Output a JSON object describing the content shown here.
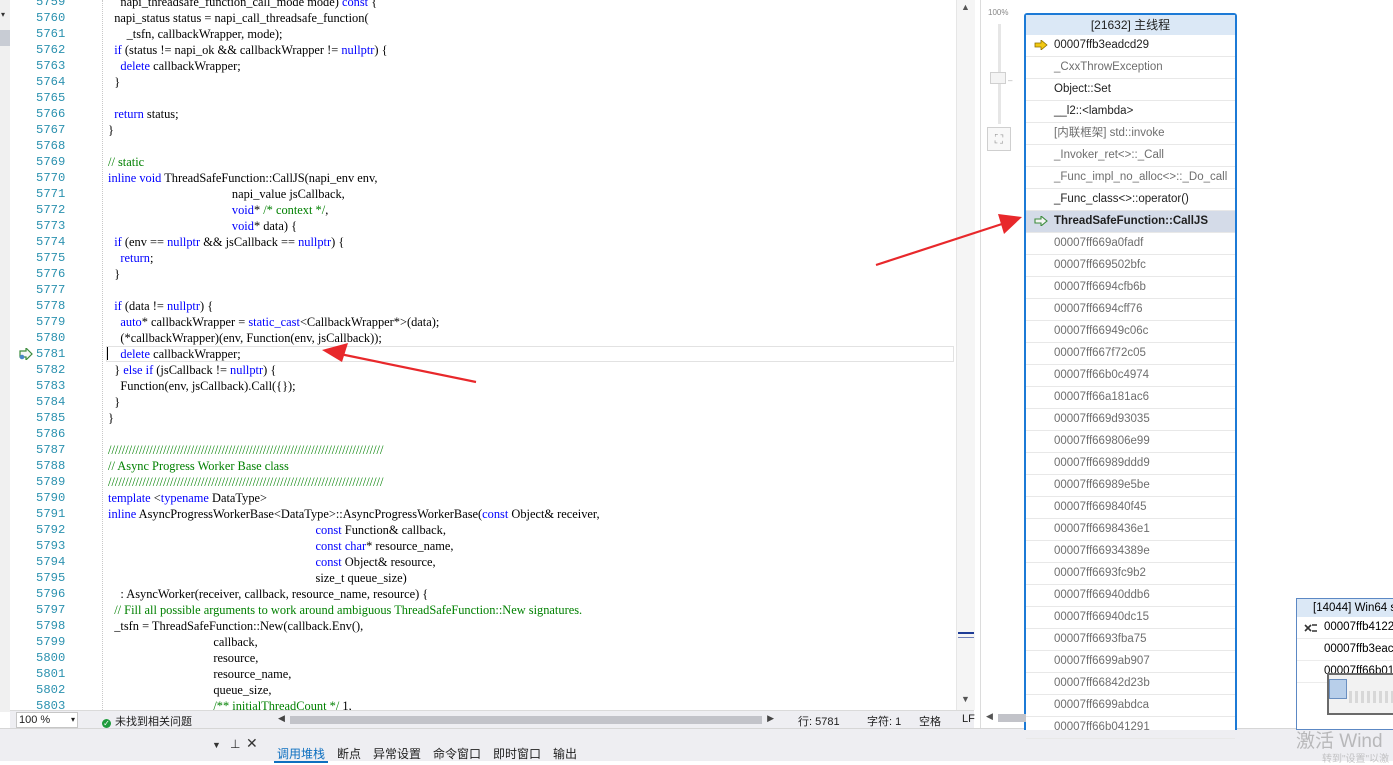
{
  "editor": {
    "zoom": "100 %",
    "issues": "未找到相关问题",
    "line_label": "行: 5781",
    "col_label": "字符: 1",
    "whitespace": "空格",
    "eol": "LF",
    "current_line": 5781,
    "breakpoint_line": 5781,
    "lines": [
      {
        "n": "5759",
        "parts": [
          [
            "",
            "    napi_threadsafe_function_call_mode mode) "
          ],
          [
            "kw",
            "const"
          ],
          [
            "",
            " {"
          ]
        ]
      },
      {
        "n": "5760",
        "parts": [
          [
            "",
            "  napi_status status = napi_call_threadsafe_function("
          ]
        ]
      },
      {
        "n": "5761",
        "parts": [
          [
            "",
            "      _tsfn, callbackWrapper, mode);"
          ]
        ]
      },
      {
        "n": "5762",
        "parts": [
          [
            "",
            "  "
          ],
          [
            "kw",
            "if"
          ],
          [
            "",
            " (status != napi_ok && callbackWrapper != "
          ],
          [
            "kw",
            "nullptr"
          ],
          [
            "",
            ") {"
          ]
        ]
      },
      {
        "n": "5763",
        "parts": [
          [
            "",
            "    "
          ],
          [
            "kw",
            "delete"
          ],
          [
            "",
            " callbackWrapper;"
          ]
        ]
      },
      {
        "n": "5764",
        "parts": [
          [
            "",
            "  }"
          ]
        ]
      },
      {
        "n": "5765",
        "parts": [
          [
            "",
            ""
          ]
        ]
      },
      {
        "n": "5766",
        "parts": [
          [
            "",
            "  "
          ],
          [
            "kw",
            "return"
          ],
          [
            "",
            " status;"
          ]
        ]
      },
      {
        "n": "5767",
        "parts": [
          [
            "",
            "}"
          ]
        ]
      },
      {
        "n": "5768",
        "parts": [
          [
            "",
            ""
          ]
        ]
      },
      {
        "n": "5769",
        "parts": [
          [
            "cm",
            "// static"
          ]
        ]
      },
      {
        "n": "5770",
        "parts": [
          [
            "kw",
            "inline"
          ],
          [
            "",
            " "
          ],
          [
            "kw",
            "void"
          ],
          [
            "",
            " ThreadSafeFunction::CallJS(napi_env env,"
          ]
        ]
      },
      {
        "n": "5771",
        "parts": [
          [
            "",
            "                                        napi_value jsCallback,"
          ]
        ]
      },
      {
        "n": "5772",
        "parts": [
          [
            "",
            "                                        "
          ],
          [
            "kw",
            "void"
          ],
          [
            "",
            "* "
          ],
          [
            "cm",
            "/* context */"
          ],
          [
            "",
            ","
          ]
        ]
      },
      {
        "n": "5773",
        "parts": [
          [
            "",
            "                                        "
          ],
          [
            "kw",
            "void"
          ],
          [
            "",
            "* data) {"
          ]
        ]
      },
      {
        "n": "5774",
        "parts": [
          [
            "",
            "  "
          ],
          [
            "kw",
            "if"
          ],
          [
            "",
            " (env == "
          ],
          [
            "kw",
            "nullptr"
          ],
          [
            "",
            " && jsCallback == "
          ],
          [
            "kw",
            "nullptr"
          ],
          [
            "",
            ") {"
          ]
        ]
      },
      {
        "n": "5775",
        "parts": [
          [
            "",
            "    "
          ],
          [
            "kw",
            "return"
          ],
          [
            "",
            ";"
          ]
        ]
      },
      {
        "n": "5776",
        "parts": [
          [
            "",
            "  }"
          ]
        ]
      },
      {
        "n": "5777",
        "parts": [
          [
            "",
            ""
          ]
        ]
      },
      {
        "n": "5778",
        "parts": [
          [
            "",
            "  "
          ],
          [
            "kw",
            "if"
          ],
          [
            "",
            " (data != "
          ],
          [
            "kw",
            "nullptr"
          ],
          [
            "",
            ") {"
          ]
        ]
      },
      {
        "n": "5779",
        "parts": [
          [
            "",
            "    "
          ],
          [
            "kw",
            "auto"
          ],
          [
            "",
            "* callbackWrapper = "
          ],
          [
            "kw",
            "static_cast"
          ],
          [
            "",
            "<CallbackWrapper*>(data);"
          ]
        ]
      },
      {
        "n": "5780",
        "parts": [
          [
            "",
            "    (*callbackWrapper)(env, Function(env, jsCallback));"
          ]
        ]
      },
      {
        "n": "5781",
        "parts": [
          [
            "",
            "    "
          ],
          [
            "kw",
            "delete"
          ],
          [
            "",
            " callbackWrapper;"
          ]
        ]
      },
      {
        "n": "5782",
        "parts": [
          [
            "",
            "  } "
          ],
          [
            "kw",
            "else"
          ],
          [
            "",
            " "
          ],
          [
            "kw",
            "if"
          ],
          [
            "",
            " (jsCallback != "
          ],
          [
            "kw",
            "nullptr"
          ],
          [
            "",
            ") {"
          ]
        ]
      },
      {
        "n": "5783",
        "parts": [
          [
            "",
            "    Function(env, jsCallback).Call({});"
          ]
        ]
      },
      {
        "n": "5784",
        "parts": [
          [
            "",
            "  }"
          ]
        ]
      },
      {
        "n": "5785",
        "parts": [
          [
            "",
            "}"
          ]
        ]
      },
      {
        "n": "5786",
        "parts": [
          [
            "",
            ""
          ]
        ]
      },
      {
        "n": "5787",
        "parts": [
          [
            "cm",
            "////////////////////////////////////////////////////////////////////////////////"
          ]
        ]
      },
      {
        "n": "5788",
        "parts": [
          [
            "cm",
            "// Async Progress Worker Base class"
          ]
        ]
      },
      {
        "n": "5789",
        "parts": [
          [
            "cm",
            "////////////////////////////////////////////////////////////////////////////////"
          ]
        ]
      },
      {
        "n": "5790",
        "parts": [
          [
            "kw",
            "template"
          ],
          [
            "",
            " <"
          ],
          [
            "kw",
            "typename"
          ],
          [
            "",
            " DataType>"
          ]
        ]
      },
      {
        "n": "5791",
        "parts": [
          [
            "kw",
            "inline"
          ],
          [
            "",
            " AsyncProgressWorkerBase<DataType>::AsyncProgressWorkerBase("
          ],
          [
            "kw",
            "const"
          ],
          [
            "",
            " Object& receiver,"
          ]
        ]
      },
      {
        "n": "5792",
        "parts": [
          [
            "",
            "                                                                   "
          ],
          [
            "kw",
            "const"
          ],
          [
            "",
            " Function& callback,"
          ]
        ]
      },
      {
        "n": "5793",
        "parts": [
          [
            "",
            "                                                                   "
          ],
          [
            "kw",
            "const"
          ],
          [
            "",
            " "
          ],
          [
            "kw",
            "char"
          ],
          [
            "",
            "* resource_name,"
          ]
        ]
      },
      {
        "n": "5794",
        "parts": [
          [
            "",
            "                                                                   "
          ],
          [
            "kw",
            "const"
          ],
          [
            "",
            " Object& resource,"
          ]
        ]
      },
      {
        "n": "5795",
        "parts": [
          [
            "",
            "                                                                   size_t queue_size)"
          ]
        ]
      },
      {
        "n": "5796",
        "parts": [
          [
            "",
            "    : AsyncWorker(receiver, callback, resource_name, resource) {"
          ]
        ]
      },
      {
        "n": "5797",
        "parts": [
          [
            "",
            "  "
          ],
          [
            "cm",
            "// Fill all possible arguments to work around ambiguous ThreadSafeFunction::New signatures."
          ]
        ]
      },
      {
        "n": "5798",
        "parts": [
          [
            "",
            "  _tsfn = ThreadSafeFunction::New(callback.Env(),"
          ]
        ]
      },
      {
        "n": "5799",
        "parts": [
          [
            "",
            "                                  callback,"
          ]
        ]
      },
      {
        "n": "5800",
        "parts": [
          [
            "",
            "                                  resource,"
          ]
        ]
      },
      {
        "n": "5801",
        "parts": [
          [
            "",
            "                                  resource_name,"
          ]
        ]
      },
      {
        "n": "5802",
        "parts": [
          [
            "",
            "                                  queue_size,"
          ]
        ]
      },
      {
        "n": "5803",
        "parts": [
          [
            "",
            "                                  "
          ],
          [
            "cm",
            "/** initialThreadCount */"
          ],
          [
            "",
            " 1,"
          ]
        ]
      }
    ]
  },
  "bottom_tabs": [
    "调用堆栈",
    "断点",
    "异常设置",
    "命令窗口",
    "即时窗口",
    "输出"
  ],
  "bottom_left_icons": [
    "dropdown-icon",
    "pin-icon",
    "close-icon"
  ],
  "parallel_stacks": {
    "zoom_pct": "100%",
    "main_thread": {
      "header": "[21632] 主线程",
      "frames": [
        {
          "text": "00007ffb3eadcd29",
          "icon": "current-arrow",
          "dim": false,
          "selected": false
        },
        {
          "text": "_CxxThrowException",
          "icon": "",
          "dim": true,
          "selected": false
        },
        {
          "text": "Object::Set",
          "icon": "",
          "dim": false,
          "selected": false
        },
        {
          "text": "__l2::<lambda>",
          "icon": "",
          "dim": false,
          "selected": false
        },
        {
          "text": "[内联框架] std::invoke",
          "icon": "",
          "dim": true,
          "selected": false
        },
        {
          "text": "_Invoker_ret<>::_Call",
          "icon": "",
          "dim": true,
          "selected": false
        },
        {
          "text": "_Func_impl_no_alloc<>::_Do_call",
          "icon": "",
          "dim": true,
          "selected": false
        },
        {
          "text": "_Func_class<>::operator()",
          "icon": "",
          "dim": false,
          "selected": false
        },
        {
          "text": "ThreadSafeFunction::CallJS",
          "icon": "active-frame-arrow",
          "dim": false,
          "selected": true
        },
        {
          "text": "00007ff669a0fadf",
          "icon": "",
          "dim": true,
          "selected": false
        },
        {
          "text": "00007ff669502bfc",
          "icon": "",
          "dim": true,
          "selected": false
        },
        {
          "text": "00007ff6694cfb6b",
          "icon": "",
          "dim": true,
          "selected": false
        },
        {
          "text": "00007ff6694cff76",
          "icon": "",
          "dim": true,
          "selected": false
        },
        {
          "text": "00007ff66949c06c",
          "icon": "",
          "dim": true,
          "selected": false
        },
        {
          "text": "00007ff667f72c05",
          "icon": "",
          "dim": true,
          "selected": false
        },
        {
          "text": "00007ff66b0c4974",
          "icon": "",
          "dim": true,
          "selected": false
        },
        {
          "text": "00007ff66a181ac6",
          "icon": "",
          "dim": true,
          "selected": false
        },
        {
          "text": "00007ff669d93035",
          "icon": "",
          "dim": true,
          "selected": false
        },
        {
          "text": "00007ff669806e99",
          "icon": "",
          "dim": true,
          "selected": false
        },
        {
          "text": "00007ff66989ddd9",
          "icon": "",
          "dim": true,
          "selected": false
        },
        {
          "text": "00007ff66989e5be",
          "icon": "",
          "dim": true,
          "selected": false
        },
        {
          "text": "00007ff669840f45",
          "icon": "",
          "dim": true,
          "selected": false
        },
        {
          "text": "00007ff6698436e1",
          "icon": "",
          "dim": true,
          "selected": false
        },
        {
          "text": "00007ff66934389e",
          "icon": "",
          "dim": true,
          "selected": false
        },
        {
          "text": "00007ff6693fc9b2",
          "icon": "",
          "dim": true,
          "selected": false
        },
        {
          "text": "00007ff66940ddb6",
          "icon": "",
          "dim": true,
          "selected": false
        },
        {
          "text": "00007ff66940dc15",
          "icon": "",
          "dim": true,
          "selected": false
        },
        {
          "text": "00007ff6693fba75",
          "icon": "",
          "dim": true,
          "selected": false
        },
        {
          "text": "00007ff6699ab907",
          "icon": "",
          "dim": true,
          "selected": false
        },
        {
          "text": "00007ff66842d23b",
          "icon": "",
          "dim": true,
          "selected": false
        },
        {
          "text": "00007ff6699abdca",
          "icon": "",
          "dim": true,
          "selected": false
        },
        {
          "text": "00007ff66b041291",
          "icon": "",
          "dim": true,
          "selected": false
        }
      ]
    },
    "worker_thread": {
      "header": "[14044] Win64 s",
      "frames": [
        {
          "text": "00007ffb4122",
          "icon": "thread-switch-icon"
        },
        {
          "text": "00007ffb3eac",
          "icon": ""
        },
        {
          "text": "00007ff66b01",
          "icon": ""
        }
      ]
    }
  },
  "watermark": {
    "line1": "激活 Wind",
    "line2": "转到\"设置\"以激"
  },
  "colors": {
    "accent": "#1c7ad6",
    "annotation_arrow": "#e8282b",
    "keyword": "#0000ff",
    "comment": "#008000",
    "line_number": "#2b91af"
  }
}
